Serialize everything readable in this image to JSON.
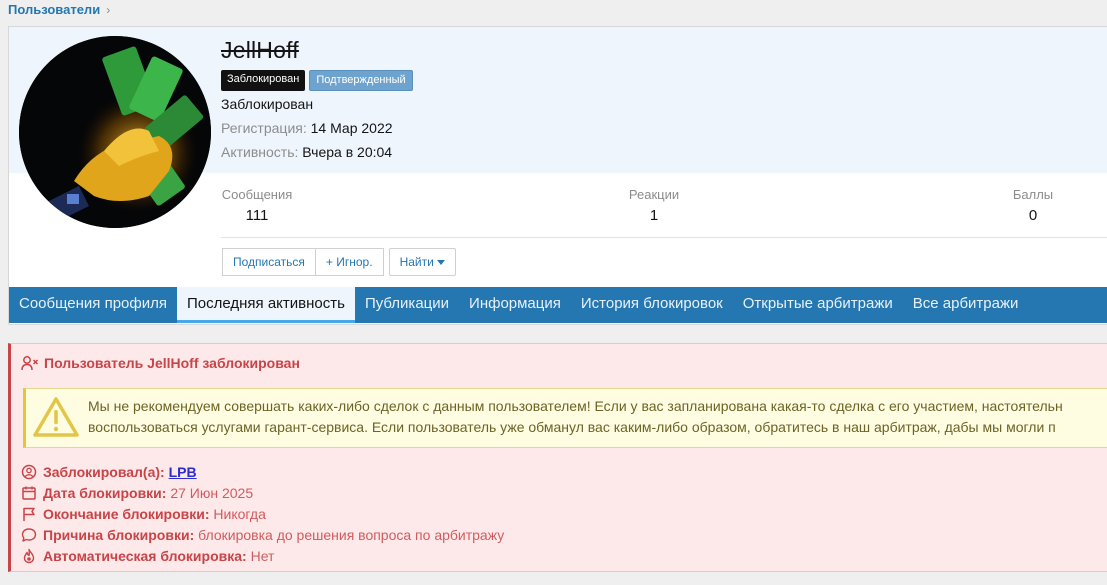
{
  "breadcrumb": {
    "label": "Пользователи",
    "chevron": "›"
  },
  "profile": {
    "username": "JellHoff",
    "badges": {
      "banned": "Заблокирован",
      "verified": "Подтвержденный"
    },
    "status": "Заблокирован",
    "registration": {
      "label": "Регистрация:",
      "value": "14 Мар 2022"
    },
    "activity": {
      "label": "Активность:",
      "value": "Вчера в 20:04"
    },
    "stats": {
      "messages": {
        "label": "Сообщения",
        "value": "111"
      },
      "reactions": {
        "label": "Реакции",
        "value": "1"
      },
      "points": {
        "label": "Баллы",
        "value": "0"
      }
    },
    "buttons": {
      "subscribe": "Подписаться",
      "ignore": "+ Игнор.",
      "find": "Найти"
    }
  },
  "tabs": [
    {
      "label": "Сообщения профиля"
    },
    {
      "label": "Последняя активность"
    },
    {
      "label": "Публикации"
    },
    {
      "label": "Информация"
    },
    {
      "label": "История блокировок"
    },
    {
      "label": "Открытые арбитражи"
    },
    {
      "label": "Все арбитражи"
    }
  ],
  "ban_notice": {
    "title": "Пользователь JellHoff заблокирован",
    "warning_line1": "Мы не рекомендуем совершать каких-либо сделок с данным пользователем! Если у вас запланирована какая-то сделка с его участием, настоятельн",
    "warning_line2": "воспользоваться услугами гарант-сервиса. Если пользователь уже обманул вас каким-либо образом, обратитесь в наш арбитраж, дабы мы могли п",
    "banned_by": {
      "label": "Заблокировал(а):",
      "value": "LPB"
    },
    "ban_date": {
      "label": "Дата блокировки:",
      "value": "27 Июн 2025"
    },
    "ban_end": {
      "label": "Окончание блокировки:",
      "value": "Никогда"
    },
    "reason": {
      "label": "Причина блокировки:",
      "value": "блокировка до решения вопроса по арбитражу"
    },
    "auto": {
      "label": "Автоматическая блокировка:",
      "value": "Нет"
    }
  },
  "colors": {
    "accent": "#2577b1",
    "danger": "#c84448",
    "warning_bg": "#fefde2"
  }
}
